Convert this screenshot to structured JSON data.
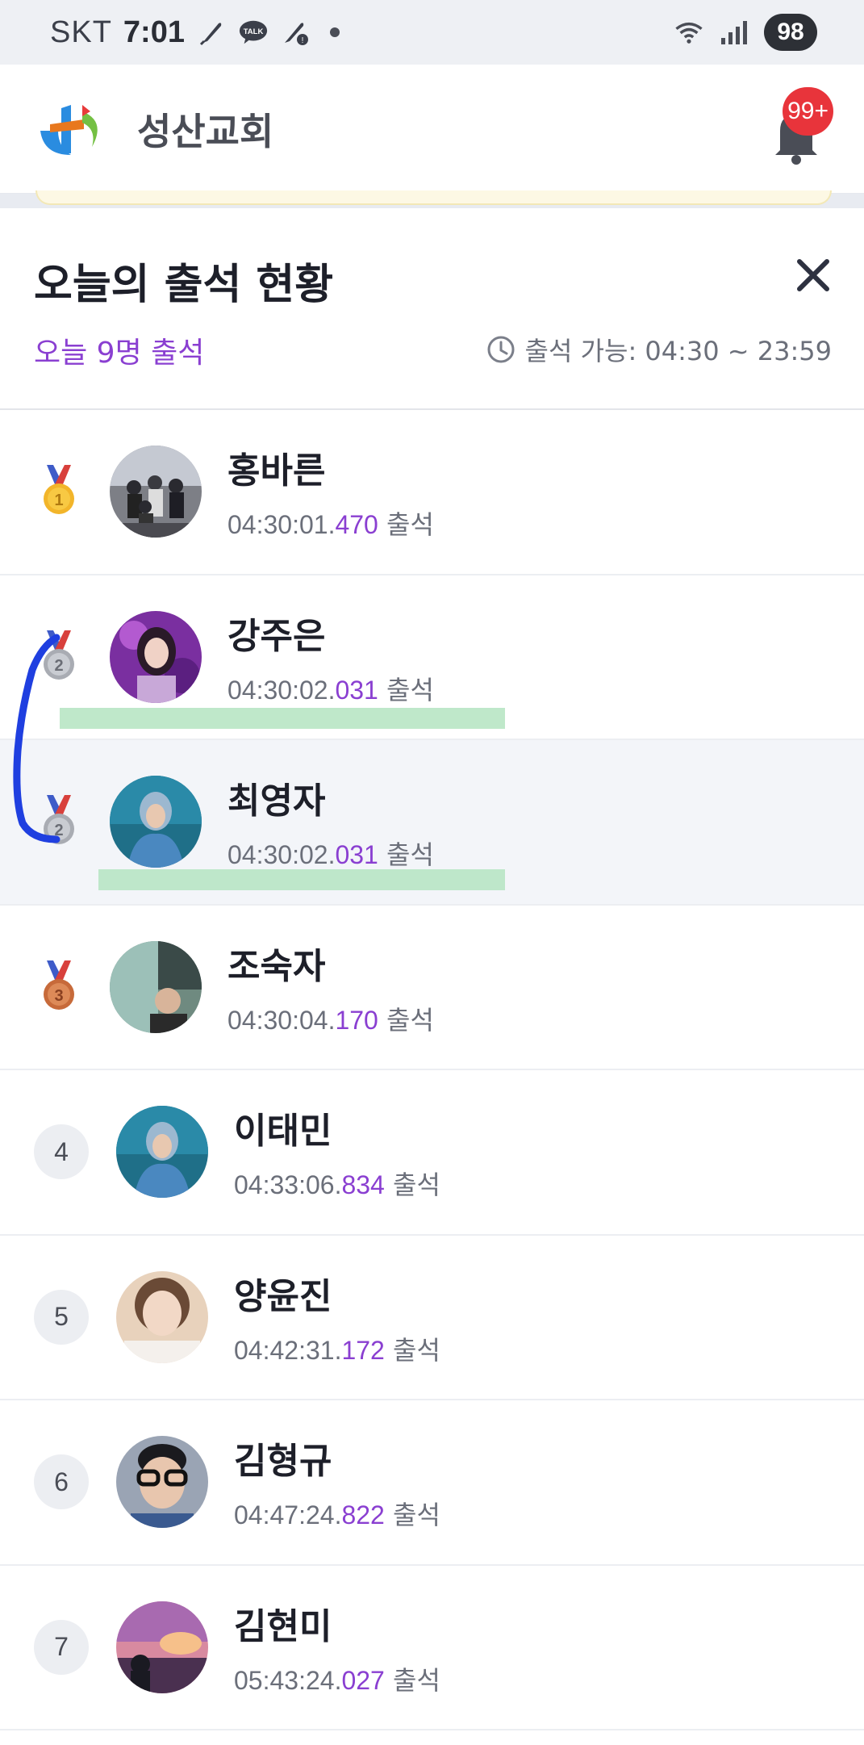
{
  "status_bar": {
    "carrier": "SKT",
    "time": "7:01",
    "battery": "98",
    "icons": [
      "feather-icon",
      "talk-icon",
      "feather-alert-icon",
      "dot-icon",
      "wifi-icon",
      "signal-icon"
    ]
  },
  "app_header": {
    "church_name": "성산교회",
    "bell_badge": "99+"
  },
  "sheet": {
    "title": "오늘의 출석 현황",
    "today_count": "오늘 9명 출석",
    "window_label": "출석 가능: 04:30 ~ 23:59"
  },
  "attendees": [
    {
      "rank": "1",
      "medal": "gold",
      "name": "홍바른",
      "time_main": "04:30:01.",
      "time_ms": "470",
      "suffix": " 출석"
    },
    {
      "rank": "2",
      "medal": "silver",
      "name": "강주은",
      "time_main": "04:30:02.",
      "time_ms": "031",
      "suffix": " 출석"
    },
    {
      "rank": "2",
      "medal": "silver",
      "name": "최영자",
      "time_main": "04:30:02.",
      "time_ms": "031",
      "suffix": " 출석"
    },
    {
      "rank": "3",
      "medal": "bronze",
      "name": "조숙자",
      "time_main": "04:30:04.",
      "time_ms": "170",
      "suffix": " 출석"
    },
    {
      "rank": "4",
      "medal": "",
      "name": "이태민",
      "time_main": "04:33:06.",
      "time_ms": "834",
      "suffix": " 출석"
    },
    {
      "rank": "5",
      "medal": "",
      "name": "양윤진",
      "time_main": "04:42:31.",
      "time_ms": "172",
      "suffix": " 출석"
    },
    {
      "rank": "6",
      "medal": "",
      "name": "김형규",
      "time_main": "04:47:24.",
      "time_ms": "822",
      "suffix": " 출석"
    },
    {
      "rank": "7",
      "medal": "",
      "name": "김현미",
      "time_main": "05:43:24.",
      "time_ms": "027",
      "suffix": " 출석"
    }
  ],
  "colors": {
    "accent_purple": "#8a3fd1",
    "badge_red": "#e8343b",
    "highlight_green": "#b8e6c4",
    "annotation_blue": "#1f3fe0"
  }
}
